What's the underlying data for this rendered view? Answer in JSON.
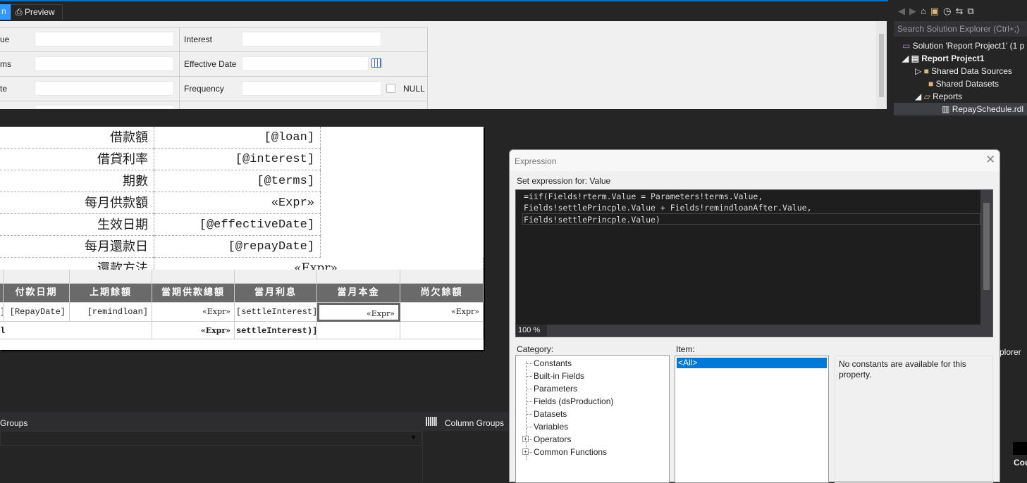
{
  "tabs": {
    "design_partial": "n",
    "preview": "Preview"
  },
  "params": {
    "rows": [
      {
        "label1": "ue",
        "label2": "Interest"
      },
      {
        "label1": "ms",
        "label2": "Effective Date"
      },
      {
        "label1": "te",
        "label2": "Frequency",
        "null_label": "NULL"
      }
    ]
  },
  "report": {
    "info": [
      {
        "label": "借款額",
        "value": "[@loan]"
      },
      {
        "label": "借貸利率",
        "value": "[@interest]"
      },
      {
        "label": "期數",
        "value": "[@terms]"
      },
      {
        "label": "每月供款額",
        "value": "«Expr»"
      },
      {
        "label": "生效日期",
        "value": "[@effectiveDate]"
      },
      {
        "label": "每月還款日",
        "value": "[@repayDate]"
      },
      {
        "label": "還款方法",
        "value": "«Expr»"
      }
    ],
    "headers": [
      "付款日期",
      "上期餘額",
      "當期供款總額",
      "當月利息",
      "當月本金",
      "尚欠餘額"
    ],
    "detail": [
      "]",
      "[RepayDate]",
      "[remindloan]",
      "«Expr»",
      "[settleInterest]",
      "«Expr»",
      "«Expr»"
    ],
    "total": {
      "label": "l",
      "expr": "«Expr»",
      "interest": "settleInterest)]"
    }
  },
  "groups": {
    "row_groups": "Groups",
    "column_groups": "Column Groups"
  },
  "solution_explorer": {
    "search_placeholder": "Search Solution Explorer (Ctrl+;)",
    "items": [
      "Solution 'Report Project1' (1 p",
      "Report Project1",
      "Shared Data Sources",
      "Shared Datasets",
      "Reports",
      "RepaySchedule.rdl"
    ],
    "partial_tab": "plorer",
    "partial_col": "Cou"
  },
  "dialog": {
    "title": "Expression",
    "set_for": "Set expression for: Value",
    "code": [
      "=iif(Fields!rterm.Value = Parameters!terms.Value,",
      "Fields!settlePrincple.Value + Fields!remindloanAfter.Value,",
      "Fields!settlePrincple.Value)"
    ],
    "zoom": "100 %",
    "category_label": "Category:",
    "categories": [
      "Constants",
      "Built-in Fields",
      "Parameters",
      "Fields (dsProduction)",
      "Datasets",
      "Variables",
      "Operators",
      "Common Functions"
    ],
    "item_label": "Item:",
    "items": [
      "<All>"
    ],
    "description": "No constants are available for this property."
  }
}
